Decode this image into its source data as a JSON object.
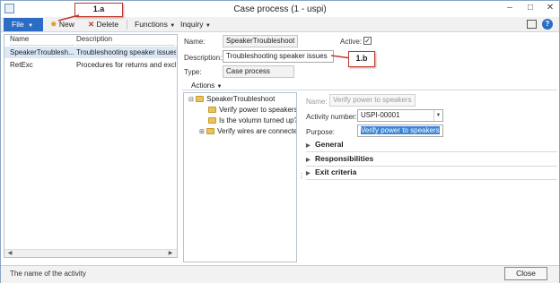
{
  "window": {
    "title": "Case process (1 - uspi)"
  },
  "toolbar": {
    "file_label": "File",
    "new_label": "New",
    "delete_label": "Delete",
    "functions_label": "Functions",
    "inquiry_label": "Inquiry"
  },
  "callouts": {
    "a": "1.a",
    "b": "1.b"
  },
  "list": {
    "columns": [
      "Name",
      "Description"
    ],
    "rows": [
      {
        "name": "SpeakerTroublesh...",
        "description": "Troubleshooting speaker issues"
      },
      {
        "name": "RetExc",
        "description": "Procedures for returns and excha"
      }
    ]
  },
  "details": {
    "name_label": "Name:",
    "name_value": "SpeakerTroubleshoot",
    "active_label": "Active:",
    "active_checked": true,
    "description_label": "Description:",
    "description_value": "Troubleshooting speaker issues",
    "type_label": "Type:",
    "type_value": "Case process",
    "actions_label": "Actions"
  },
  "tree": {
    "root": "SpeakerTroubleshoot",
    "items": [
      "Verify power to speakers",
      "Is the volumn turned up?",
      "Verify wires are connecte"
    ]
  },
  "activity": {
    "name_label": "Name:",
    "name_value": "Verify power to speakers",
    "number_label": "Activity number:",
    "number_value": "USPI-00001",
    "purpose_label": "Purpose:",
    "purpose_value": "Verify power to speakers",
    "sections": [
      "General",
      "Responsibilities",
      "Exit criteria"
    ]
  },
  "status": {
    "text": "The name of the activity",
    "close_label": "Close"
  },
  "colors": {
    "accent": "#2b6cc4",
    "callout_border": "#c0392b",
    "selection": "#dbe8f6"
  }
}
